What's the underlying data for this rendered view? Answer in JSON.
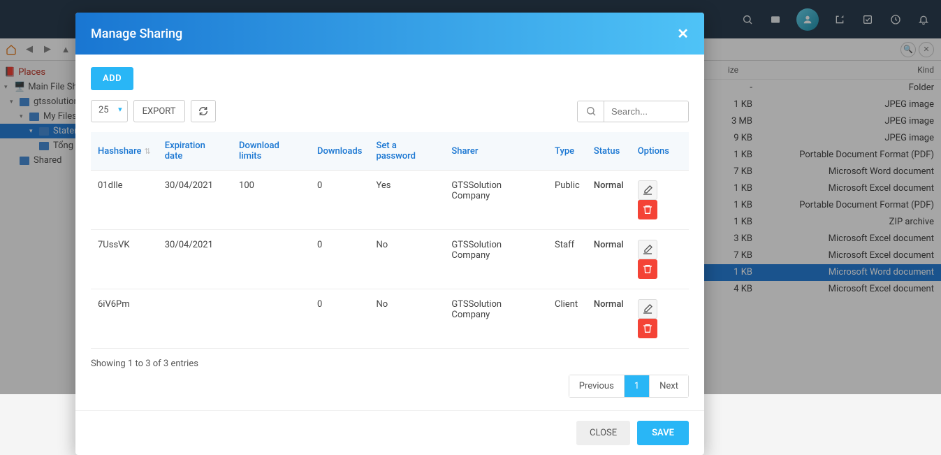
{
  "sidebar": {
    "places": "Places",
    "main_file_share": "Main File Sh",
    "gtssolution": "gtssolution",
    "my_files": "My Files",
    "statements": "Staten",
    "tong": "Tổng",
    "shared": "Shared"
  },
  "file_header": {
    "size": "ize",
    "kind": "Kind"
  },
  "files": [
    {
      "size": "-",
      "kind": "Folder"
    },
    {
      "size": "1 KB",
      "kind": "JPEG image"
    },
    {
      "size": "3 MB",
      "kind": "JPEG image"
    },
    {
      "size": "9 KB",
      "kind": "JPEG image"
    },
    {
      "size": "1 KB",
      "kind": "Portable Document Format (PDF)"
    },
    {
      "size": "7 KB",
      "kind": "Microsoft Word document"
    },
    {
      "size": "1 KB",
      "kind": "Microsoft Excel document"
    },
    {
      "size": "1 KB",
      "kind": "Portable Document Format (PDF)"
    },
    {
      "size": "1 KB",
      "kind": "ZIP archive"
    },
    {
      "size": "3 KB",
      "kind": "Microsoft Excel document"
    },
    {
      "size": "7 KB",
      "kind": "Microsoft Excel document"
    },
    {
      "size": "1 KB",
      "kind": "Microsoft Word document",
      "selected": true
    },
    {
      "size": "4 KB",
      "kind": "Microsoft Excel document"
    }
  ],
  "modal": {
    "title": "Manage Sharing",
    "add": "ADD",
    "page_size": "25",
    "export": "EXPORT",
    "search_placeholder": "Search...",
    "columns": {
      "hashshare": "Hashshare",
      "expiration": "Expiration date",
      "download_limits": "Download limits",
      "downloads": "Downloads",
      "password": "Set a password",
      "sharer": "Sharer",
      "type": "Type",
      "status": "Status",
      "options": "Options"
    },
    "rows": [
      {
        "hash": "01dIle",
        "exp": "30/04/2021",
        "limits": "100",
        "downloads": "0",
        "password": "Yes",
        "sharer": "GTSSolution Company",
        "type": "Public",
        "status": "Normal"
      },
      {
        "hash": "7UssVK",
        "exp": "30/04/2021",
        "limits": "",
        "downloads": "0",
        "password": "No",
        "sharer": "GTSSolution Company",
        "type": "Staff",
        "status": "Normal"
      },
      {
        "hash": "6iV6Pm",
        "exp": "",
        "limits": "",
        "downloads": "0",
        "password": "No",
        "sharer": "GTSSolution Company",
        "type": "Client",
        "status": "Normal"
      }
    ],
    "info": "Showing 1 to 3 of 3 entries",
    "prev": "Previous",
    "page": "1",
    "next": "Next",
    "close": "CLOSE",
    "save": "SAVE"
  }
}
